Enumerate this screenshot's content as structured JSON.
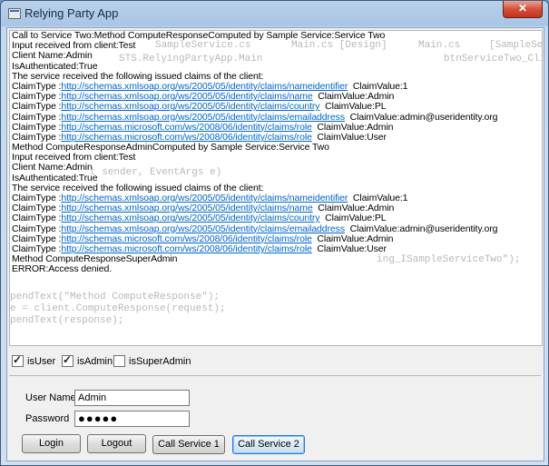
{
  "window": {
    "title": "Relying Party App",
    "close_label": "✕"
  },
  "log": {
    "lines": [
      {
        "text": "Call to Service Two:Method ComputeResponseComputed by Sample Service:Service Two"
      },
      {
        "text": "Input received from client:Test"
      },
      {
        "text": "Client Name:Admin"
      },
      {
        "text": "IsAuthenticated:True"
      },
      {
        "text": "The service received the following issued claims of the client:"
      },
      {
        "prefix": "ClaimType :",
        "link": "http://schemas.xmlsoap.org/ws/2005/05/identity/claims/nameidentifier",
        "suffix": "  ClaimValue:1"
      },
      {
        "prefix": "ClaimType :",
        "link": "http://schemas.xmlsoap.org/ws/2005/05/identity/claims/name",
        "suffix": "  ClaimValue:Admin"
      },
      {
        "prefix": "ClaimType :",
        "link": "http://schemas.xmlsoap.org/ws/2005/05/identity/claims/country",
        "suffix": "  ClaimValue:PL"
      },
      {
        "prefix": "ClaimType :",
        "link": "http://schemas.xmlsoap.org/ws/2005/05/identity/claims/emailaddress",
        "suffix": "  ClaimValue:admin@useridentity.org"
      },
      {
        "prefix": "ClaimType :",
        "link": "http://schemas.microsoft.com/ws/2008/06/identity/claims/role",
        "suffix": "  ClaimValue:Admin"
      },
      {
        "prefix": "ClaimType :",
        "link": "http://schemas.microsoft.com/ws/2008/06/identity/claims/role",
        "suffix": "  ClaimValue:User"
      },
      {
        "text": "Method ComputeResponseAdminComputed by Sample Service:Service Two"
      },
      {
        "text": "Input received from client:Test"
      },
      {
        "text": "Client Name:Admin"
      },
      {
        "text": "IsAuthenticated:True"
      },
      {
        "text": "The service received the following issued claims of the client:"
      },
      {
        "prefix": "ClaimType :",
        "link": "http://schemas.xmlsoap.org/ws/2005/05/identity/claims/nameidentifier",
        "suffix": "  ClaimValue:1"
      },
      {
        "prefix": "ClaimType :",
        "link": "http://schemas.xmlsoap.org/ws/2005/05/identity/claims/name",
        "suffix": "  ClaimValue:Admin"
      },
      {
        "prefix": "ClaimType :",
        "link": "http://schemas.xmlsoap.org/ws/2005/05/identity/claims/country",
        "suffix": "  ClaimValue:PL"
      },
      {
        "prefix": "ClaimType :",
        "link": "http://schemas.xmlsoap.org/ws/2005/05/identity/claims/emailaddress",
        "suffix": "  ClaimValue:admin@useridentity.org"
      },
      {
        "prefix": "ClaimType :",
        "link": "http://schemas.microsoft.com/ws/2008/06/identity/claims/role",
        "suffix": "  ClaimValue:Admin"
      },
      {
        "prefix": "ClaimType :",
        "link": "http://schemas.microsoft.com/ws/2008/06/identity/claims/role",
        "suffix": "  ClaimValue:User"
      },
      {
        "text": "Method ComputeResponseSuperAdmin"
      },
      {
        "text": "ERROR:Access denied."
      }
    ],
    "ghost_text": [
      "SampleService.cs",
      "Main.cs [Design]",
      "Main.cs",
      "[SampleSer",
      "STS.RelyingPartyApp.Main",
      "btnServiceTwo_Click",
      "t sender, EventArgs e)",
      "ing_ISampleServiceTwo\");",
      "pendText(\"Method ComputeResponse\");",
      "e = client.ComputeResponse(request);",
      "pendText(response);"
    ]
  },
  "checkboxes": [
    {
      "label": "isUser",
      "checked": true
    },
    {
      "label": "isAdmin",
      "checked": true
    },
    {
      "label": "isSuperAdmin",
      "checked": false
    }
  ],
  "form": {
    "username_label": "User Name",
    "username_value": "Admin",
    "password_label": "Password",
    "password_value": "●●●●●"
  },
  "buttons": {
    "login": "Login",
    "logout": "Logout",
    "call_service_1": "Call Service 1",
    "call_service_2": "Call Service 2"
  }
}
